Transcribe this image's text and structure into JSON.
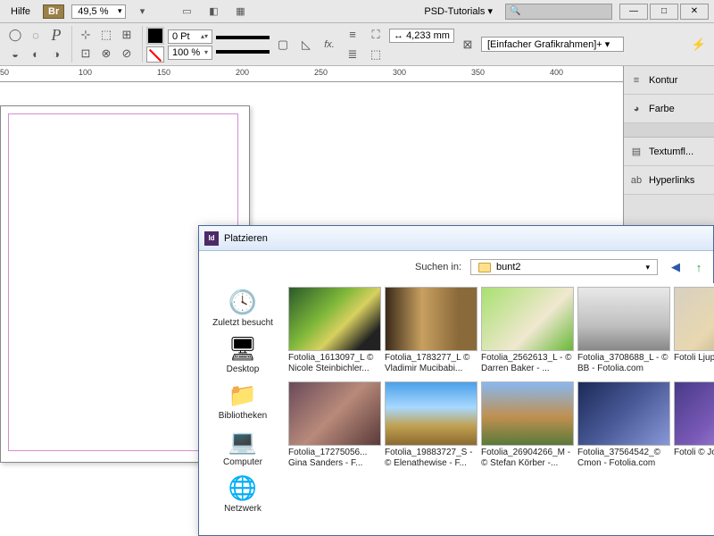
{
  "menubar": {
    "help": "Hilfe",
    "zoom": "49,5 %",
    "tutorials": "PSD-Tutorials"
  },
  "toolbar": {
    "stroke": "0 Pt",
    "opacity": "100 %",
    "dim": "4,233 mm",
    "frame_preset": "[Einfacher Grafikrahmen]+"
  },
  "ruler": {
    "ticks": [
      "50",
      "100",
      "150",
      "200",
      "250",
      "300",
      "350",
      "400"
    ]
  },
  "panels": [
    {
      "icon": "≡",
      "label": "Kontur"
    },
    {
      "icon": "◕",
      "label": "Farbe"
    },
    {
      "gap": true
    },
    {
      "icon": "▤",
      "label": "Textumfl..."
    },
    {
      "icon": "ab",
      "label": "Hyperlinks"
    }
  ],
  "dialog": {
    "title": "Platzieren",
    "search_label": "Suchen in:",
    "folder": "bunt2",
    "places": [
      {
        "icon": "🕓",
        "label": "Zuletzt besucht"
      },
      {
        "icon": "🖥",
        "label": "Desktop"
      },
      {
        "icon": "📁",
        "label": "Bibliotheken"
      },
      {
        "icon": "💻",
        "label": "Computer"
      },
      {
        "icon": "🌐",
        "label": "Netzwerk"
      }
    ],
    "row1": [
      {
        "t": "t1",
        "name": "Fotolia_1613097_L © Nicole Steinbichler..."
      },
      {
        "t": "t2",
        "name": "Fotolia_1783277_L © Vladimir Mucibabi..."
      },
      {
        "t": "t3",
        "name": "Fotolia_2562613_L - © Darren Baker - ..."
      },
      {
        "t": "t4",
        "name": "Fotolia_3708688_L - © BB - Fotolia.com"
      },
      {
        "t": "t5",
        "name": "Fotoli Ljupco"
      }
    ],
    "row2": [
      {
        "t": "t6",
        "name": "Fotolia_17275056... Gina Sanders - F..."
      },
      {
        "t": "t7",
        "name": "Fotolia_19883727_S - © Elenathewise - F..."
      },
      {
        "t": "t8",
        "name": "Fotolia_26904266_M - © Stefan Körber -..."
      },
      {
        "t": "t9",
        "name": "Fotolia_37564542_© Cmon - Fotolia.com"
      },
      {
        "t": "t10",
        "name": "Fotoli © Joha"
      }
    ]
  }
}
